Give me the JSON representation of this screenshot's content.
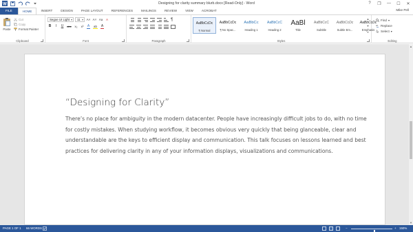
{
  "window": {
    "title": "Designing for clarity summary blurb.docx [Read-Only] - Word",
    "controls": {
      "help": "?",
      "restore": "❐",
      "minimize": "—",
      "maximize": "☐",
      "close": "✕"
    }
  },
  "quick_access": {
    "icons": [
      "word-logo-icon",
      "save-icon",
      "undo-icon",
      "redo-icon",
      "customize-icon"
    ]
  },
  "tabs": [
    "FILE",
    "HOME",
    "INSERT",
    "DESIGN",
    "PAGE LAYOUT",
    "REFERENCES",
    "MAILINGS",
    "REVIEW",
    "VIEW",
    "ACROBAT"
  ],
  "active_tab": "HOME",
  "user": {
    "name": "Mike Pell"
  },
  "ribbon": {
    "clipboard": {
      "label": "Clipboard",
      "paste": "Paste",
      "cut": "Cut",
      "copy": "Copy",
      "format_painter": "Format Painter"
    },
    "font": {
      "label": "Font",
      "font_name": "Segoe UI Light",
      "font_size": "11",
      "grow": "A˄",
      "shrink": "A˅",
      "case": "Aa",
      "clear": "A",
      "bold": "B",
      "italic": "I",
      "underline": "U",
      "strike": "abc",
      "subscript": "x₂",
      "superscript": "x²",
      "text_effects": "A",
      "highlight": "ab",
      "font_color": "A"
    },
    "paragraph": {
      "label": "Paragraph",
      "pilcrow": "¶"
    },
    "styles": {
      "label": "Styles",
      "items": [
        {
          "sample": "AaBbCcDc",
          "name": "¶ Normal"
        },
        {
          "sample": "AaBbCcDc",
          "name": "¶ No Spac..."
        },
        {
          "sample": "AaBbCc",
          "name": "Heading 1"
        },
        {
          "sample": "AaBbCcC",
          "name": "Heading 2"
        },
        {
          "sample": "AaBl",
          "name": "Title"
        },
        {
          "sample": "AaBbCcC",
          "name": "Subtitle"
        },
        {
          "sample": "AaBbCcDc",
          "name": "Subtle Em..."
        },
        {
          "sample": "AaBbCcDc",
          "name": "Emphasis"
        }
      ],
      "selected_index": 0
    },
    "editing": {
      "label": "Editing",
      "find": "Find",
      "replace": "Replace",
      "select": "Select"
    }
  },
  "document": {
    "title": "“Designing for Clarity”",
    "body": "There’s no place for ambiguity in the modern datacenter. People have increasingly difficult jobs to do, with no time for costly mistakes. When studying workflow, it becomes obvious very quickly that being glanceable, clear and understandable are the keys to efficient display and communication. This talk focuses on lessons learned and best practices for delivering clarity in any of your information displays, visualizations and communications."
  },
  "status_bar": {
    "page": "PAGE 1 OF 1",
    "words": "66 WORDS",
    "zoom": "150%",
    "zoom_minus": "−",
    "zoom_plus": "+"
  },
  "colors": {
    "accent": "#2b579a",
    "highlight_yellow": "#f5e400",
    "font_red": "#d13438",
    "text_effect_blue": "#3c78c8"
  }
}
